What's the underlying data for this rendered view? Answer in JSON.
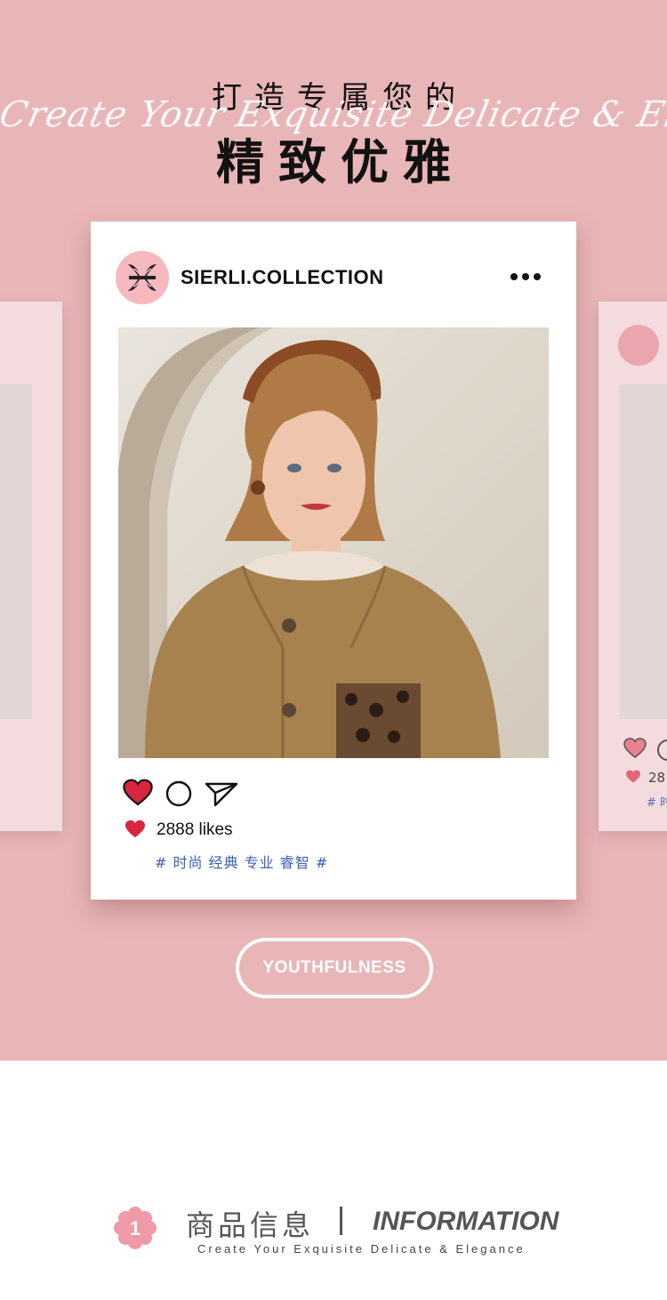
{
  "hero": {
    "title_top": "打造专属您的",
    "script": "Create Your Exquisite Delicate & Elegance",
    "title_main": "精致优雅"
  },
  "post": {
    "handle": "SIERLI.COLLECTION",
    "likes": "2888 likes",
    "hashtags": "# 时尚 经典 专业 睿智 #"
  },
  "side_right": {
    "likes_partial": "28",
    "tag_partial": "# 时"
  },
  "badge": {
    "label": "YOUTHFULNESS"
  },
  "info": {
    "number": "1",
    "cn": "商品信息",
    "en": "INFORMATION",
    "subtitle": "Create Your Exquisite Delicate & Elegance"
  },
  "colors": {
    "hero_bg": "#e9b6b8",
    "heart": "#d8263f",
    "hashtag": "#3c5fb0"
  }
}
